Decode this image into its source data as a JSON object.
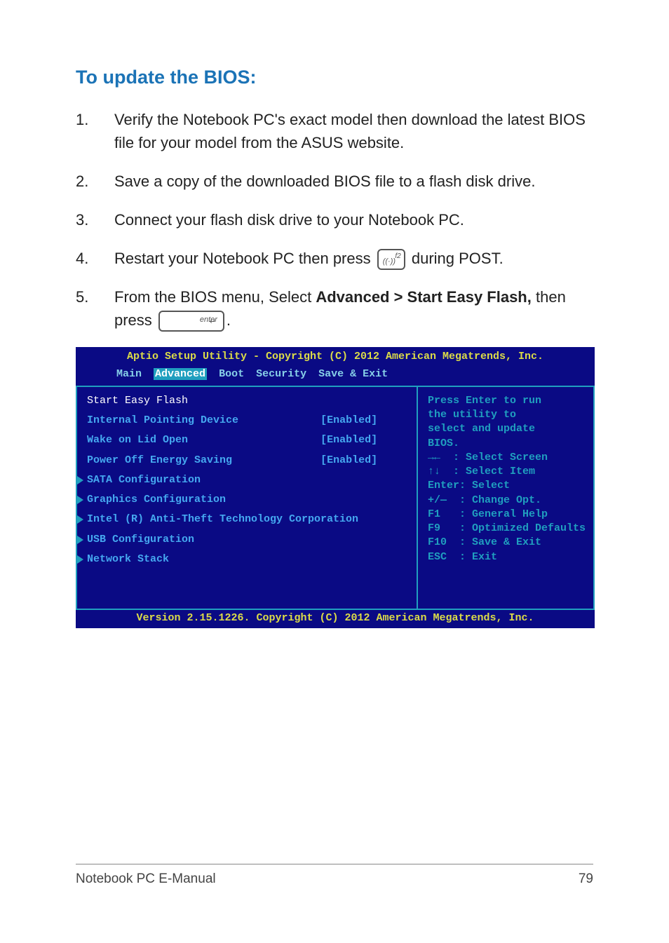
{
  "heading": "To update the BIOS:",
  "steps": {
    "s1_num": "1.",
    "s1_body": "Verify the Notebook PC's exact model then download the latest BIOS file for your model from the ASUS website.",
    "s2_num": "2.",
    "s2_body": "Save a copy of the downloaded BIOS file to a flash disk drive.",
    "s3_num": "3.",
    "s3_body": "Connect your flash disk drive to your Notebook PC.",
    "s4_num": "4.",
    "s4_pre": "Restart your Notebook PC then press ",
    "s4_post": " during POST.",
    "s4_key_top": "f2",
    "s5_num": "5.",
    "s5_pre": "From the BIOS menu, Select ",
    "s5_bold": "Advanced > Start Easy Flash,",
    "s5_mid": " then press ",
    "s5_post": ".",
    "s5_key_label": "enter",
    "s5_key_arrow": "↵"
  },
  "bios": {
    "title": "Aptio Setup Utility - Copyright (C) 2012 American Megatrends, Inc.",
    "tabs": {
      "main": "Main",
      "advanced": "Advanced",
      "boot": "Boot",
      "security": "Security",
      "save": "Save & Exit"
    },
    "left": {
      "selected": "Start Easy Flash",
      "row1_label": "Internal Pointing Device",
      "row1_val": "[Enabled]",
      "row2_label": "Wake on Lid Open",
      "row2_val": "[Enabled]",
      "row3_label": "Power Off Energy Saving",
      "row3_val": "[Enabled]",
      "sub1": "SATA Configuration",
      "sub2": "Graphics Configuration",
      "sub3": "Intel (R) Anti-Theft Technology Corporation",
      "sub4": "USB Configuration",
      "sub5": "Network Stack"
    },
    "right": {
      "help1": "Press Enter to run\nthe utility to\nselect and update\nBIOS.",
      "help2": "→←  : Select Screen\n↑↓  : Select Item\nEnter: Select\n+/—  : Change Opt.\nF1   : General Help\nF9   : Optimized Defaults\nF10  : Save & Exit\nESC  : Exit"
    },
    "footer": "Version 2.15.1226. Copyright (C) 2012 American Megatrends, Inc."
  },
  "footer": {
    "title": "Notebook PC E-Manual",
    "page": "79"
  }
}
